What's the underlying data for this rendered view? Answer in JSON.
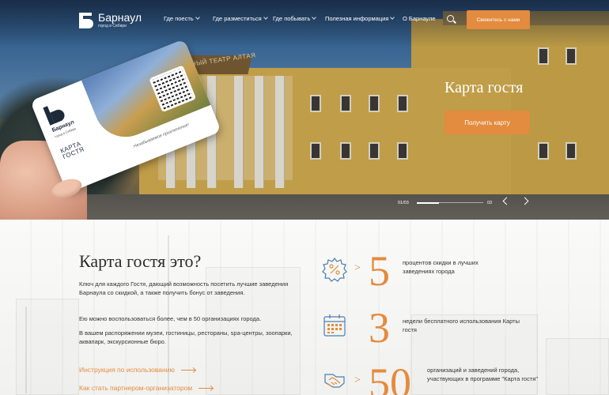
{
  "logo": {
    "name": "Барнаул",
    "sub": "город в Сибири"
  },
  "nav": [
    {
      "label": "Где поесть",
      "dropdown": true
    },
    {
      "label": "Где разместиться",
      "dropdown": true
    },
    {
      "label": "Где побывать",
      "dropdown": true
    },
    {
      "label": "Полезная информация",
      "dropdown": true
    },
    {
      "label": "О Барнауле",
      "dropdown": false
    }
  ],
  "header": {
    "contact_label": "Свяжитесь с нами"
  },
  "hero": {
    "title": "Карта гостя",
    "cta_label": "Получить карту",
    "building_sign": "МОЛОДЕЖНЫЙ ТЕАТР АЛТАЯ",
    "slide_current": "01/03",
    "slide_total": "03",
    "progress_fraction": 0.33
  },
  "card": {
    "name": "Барнаул",
    "small": "город в Сибири",
    "guest": "КАРТА ГОСТЯ",
    "slogan": "Незабываемое приключение!"
  },
  "about": {
    "title": "Карта гостя это?",
    "paragraphs": [
      "Ключ для каждого Гостя, дающий возможность посетить лучшие заведения Барнаула со скидкой, а также получить бонус от заведения.",
      "Ею можно воспользоваться более, чем в 50 организациях  города.",
      "В вашем распоряжении музеи, гостиницы, рестораны, spa-центры, зоопарки, аквапарк, экскурсионные бюро."
    ],
    "links": [
      "Инструкция по использованию",
      "Как стать партнером-организатором"
    ]
  },
  "stats": [
    {
      "icon": "percent-badge-icon",
      "prefix": ">",
      "number": "5",
      "text": "процентов скидки в лучших заведениях города"
    },
    {
      "icon": "calendar-icon",
      "prefix": "",
      "number": "3",
      "text": "недели бесплатного использования Карты гостя"
    },
    {
      "icon": "handshake-icon",
      "prefix": ">",
      "number": "50",
      "text": "организаций и заведений города, участвующих в программе  \"Карта гостя\""
    }
  ],
  "colors": {
    "accent": "#e38b3e",
    "text": "#333333"
  }
}
